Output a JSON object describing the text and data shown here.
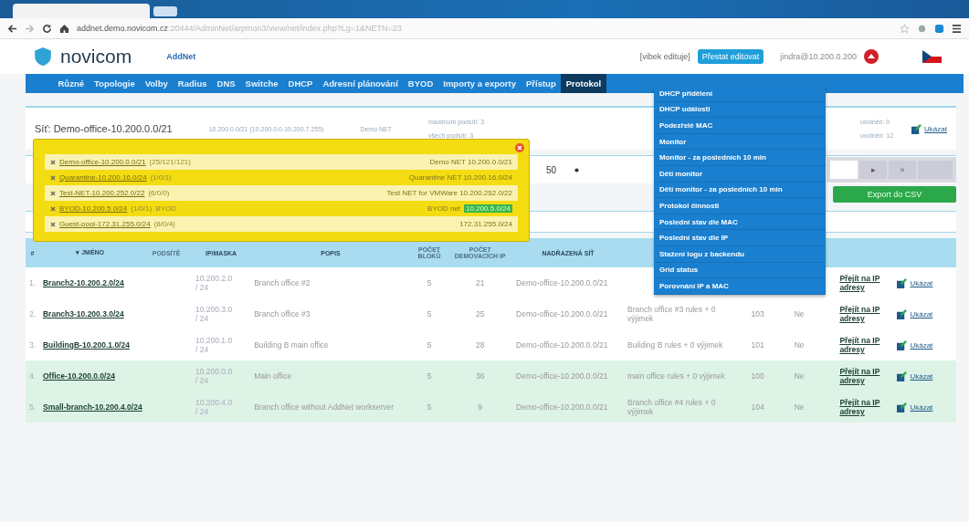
{
  "browser": {
    "url_host": "addnet.demo.novicom.cz",
    "url_path": ":20444/AdminNet/arpmon3/view/net/index.php?Lg=1&NETN=23"
  },
  "header": {
    "logo": "novicom",
    "app": "AddNet",
    "editor_note": "[vibek edituje]",
    "stop_edit_button": "Přestat editovat",
    "user": "jindra@10.200.0.200"
  },
  "nav": [
    {
      "label": "Různé",
      "selected": false
    },
    {
      "label": "Topologie",
      "selected": false
    },
    {
      "label": "Volby",
      "selected": false
    },
    {
      "label": "Radius",
      "selected": false
    },
    {
      "label": "DNS",
      "selected": false
    },
    {
      "label": "Switche",
      "selected": false
    },
    {
      "label": "DHCP",
      "selected": false
    },
    {
      "label": "Adresní plánování",
      "selected": false
    },
    {
      "label": "BYOD",
      "selected": false
    },
    {
      "label": "Importy a exporty",
      "selected": false
    },
    {
      "label": "Přístup",
      "selected": false
    },
    {
      "label": "Protokol",
      "selected": true
    }
  ],
  "menu": [
    "DHCP přidělení",
    "DHCP události",
    "Podezřelé MAC",
    "Monitor",
    "Monitor - za posledních 10 min",
    "Dětí monitor",
    "Dětí monitor - za posledních 10 min",
    "Protokol činnosti",
    "Poslední stav dle MAC",
    "Poslední stav dle IP",
    "Stažení logu z backendu",
    "Grid status",
    "Porovnání IP a MAC"
  ],
  "net_info": {
    "title": "Síť: Demo-office-10.200.0.0/21",
    "range": "10.200.0.0/21 (10.200.0.0-10.200.7.255)",
    "group": "Demo NET",
    "max_subnets": "maximum podsítí: 3",
    "all_subnets": "všech podsítí: 3",
    "right_1": "uvolněn: 0",
    "right_2": "uvolněn: 12",
    "show_link": "Ukázat"
  },
  "controls": {
    "page_size": "50",
    "next": "▸",
    "last": "»",
    "export_button": "Export do CSV"
  },
  "tree_popup": {
    "items": [
      {
        "name": "Demo-office-10.200.0.0/21",
        "counts": "(25/121/121)",
        "right": "Demo NET 10.200.0.0/21"
      },
      {
        "name": "Quarantine-10.200.16.0/24",
        "counts": "(1/0/1)",
        "right": "Quarantine NET 10.200.16.0/24"
      },
      {
        "name": "Test-NET-10.200.252.0/22",
        "counts": "(6/0/0)",
        "right": "Test NET for VMWare 10.200.252.0/22"
      },
      {
        "name": "BYOD-10.200.5.0/24",
        "counts": "(1/0/1)",
        "tag": "BYOD",
        "right": "BYOD net",
        "highlight": "10.200.5.0/24"
      },
      {
        "name": "Guest-pool-172.31.255.0/24",
        "counts": "(8/0/4)",
        "right": "172.31.255.0/24"
      }
    ]
  },
  "table": {
    "columns": [
      "#",
      "▾ JMÉNO",
      "PODSÍTĚ",
      "IP/MASKA",
      "POPIS",
      "POČET BLOKŮ",
      "POČET DEMOVACÍCH IP",
      "NADŘAZENÁ SÍŤ"
    ],
    "rows": [
      {
        "num": "1.",
        "name": "Branch2-10.200.2.0/24",
        "ip": "10.200.2.0 / 24",
        "desc": "Branch office #2",
        "blocks": "5",
        "hosts": "21",
        "parent": "Demo-office-10.200.0.0/21",
        "goto": "Přejít na IP adresy",
        "show": "Ukázat",
        "highlighted": false
      },
      {
        "num": "2.",
        "name": "Branch3-10.200.3.0/24",
        "ip": "10.200.3.0 / 24",
        "desc": "Branch office #3",
        "blocks": "5",
        "hosts": "25",
        "parent": "Demo-office-10.200.0.0/21",
        "rules": "Branch office #3 rules + 0 výjimek",
        "vlan": "103",
        "flag": "Ne",
        "goto": "Přejít na IP adresy",
        "show": "Ukázat",
        "highlighted": false
      },
      {
        "num": "3.",
        "name": "BuildingB-10.200.1.0/24",
        "ip": "10.200.1.0 / 24",
        "desc": "Building B main office",
        "blocks": "5",
        "hosts": "28",
        "parent": "Demo-office-10.200.0.0/21",
        "rules": "Building B rules + 0 výjimek",
        "vlan": "101",
        "flag": "Ne",
        "goto": "Přejít na IP adresy",
        "show": "Ukázat",
        "highlighted": false
      },
      {
        "num": "4.",
        "name": "Office-10.200.0.0/24",
        "ip": "10.200.0.0 / 24",
        "desc": "Main office",
        "blocks": "5",
        "hosts": "36",
        "parent": "Demo-office-10.200.0.0/21",
        "rules": "main office rules + 0 výjimek",
        "vlan": "100",
        "flag": "Ne",
        "goto": "Přejít na IP adresy",
        "show": "Ukázat",
        "highlighted": true
      },
      {
        "num": "5.",
        "name": "Small-branch-10.200.4.0/24",
        "ip": "10.200.4.0 / 24",
        "desc": "Branch office without AddNet workserver",
        "blocks": "5",
        "hosts": "9",
        "parent": "Demo-office-10.200.0.0/21",
        "rules": "Branch office #4 rules + 0 výjimek",
        "vlan": "104",
        "flag": "Ne",
        "goto": "Přejít na IP adresy",
        "show": "Ukázat",
        "highlighted": true
      }
    ]
  }
}
